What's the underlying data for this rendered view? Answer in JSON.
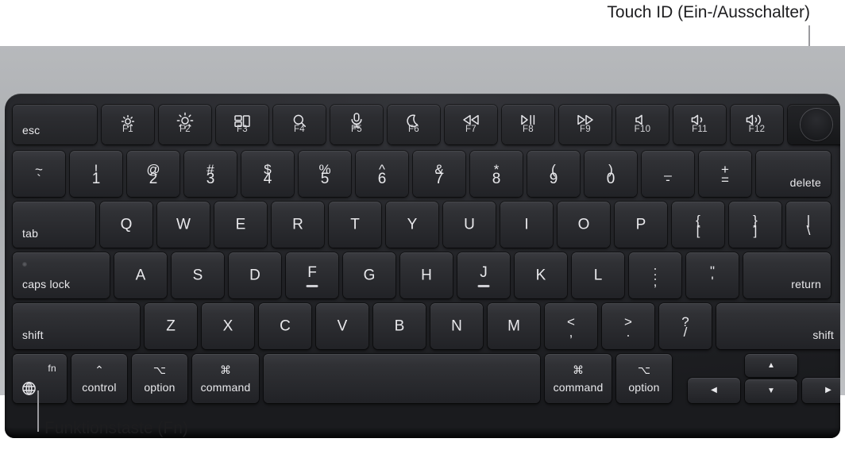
{
  "callouts": {
    "top": "Touch ID (Ein-/Ausschalter)",
    "bottom": "Funktionstaste (Fn)"
  },
  "colors": {
    "key_face": "#303135",
    "key_text": "#e9e9ec",
    "frame": "#26272b",
    "body": "#b7b9bc",
    "callout_text": "#1d1d1f",
    "leader_line": "#9a9a9e"
  },
  "keyboard": {
    "function_row": [
      {
        "name": "esc",
        "label": "esc",
        "fkey": ""
      },
      {
        "name": "brightness-down",
        "icon": "brightness-low-icon",
        "fkey": "F1"
      },
      {
        "name": "brightness-up",
        "icon": "brightness-high-icon",
        "fkey": "F2"
      },
      {
        "name": "mission-control",
        "icon": "mission-control-icon",
        "fkey": "F3"
      },
      {
        "name": "spotlight",
        "icon": "search-icon",
        "fkey": "F4"
      },
      {
        "name": "dictation",
        "icon": "microphone-icon",
        "fkey": "F5"
      },
      {
        "name": "do-not-disturb",
        "icon": "moon-icon",
        "fkey": "F6"
      },
      {
        "name": "rewind",
        "icon": "rewind-icon",
        "fkey": "F7"
      },
      {
        "name": "play-pause",
        "icon": "play-pause-icon",
        "fkey": "F8"
      },
      {
        "name": "fast-forward",
        "icon": "fast-forward-icon",
        "fkey": "F9"
      },
      {
        "name": "mute",
        "icon": "volume-mute-icon",
        "fkey": "F10"
      },
      {
        "name": "volume-down",
        "icon": "volume-down-icon",
        "fkey": "F11"
      },
      {
        "name": "volume-up",
        "icon": "volume-up-icon",
        "fkey": "F12"
      },
      {
        "name": "touch-id",
        "icon": "touch-id-icon",
        "fkey": ""
      }
    ],
    "number_row": [
      {
        "top": "~",
        "bottom": "`"
      },
      {
        "top": "!",
        "bottom": "1"
      },
      {
        "top": "@",
        "bottom": "2"
      },
      {
        "top": "#",
        "bottom": "3"
      },
      {
        "top": "$",
        "bottom": "4"
      },
      {
        "top": "%",
        "bottom": "5"
      },
      {
        "top": "^",
        "bottom": "6"
      },
      {
        "top": "&",
        "bottom": "7"
      },
      {
        "top": "*",
        "bottom": "8"
      },
      {
        "top": "(",
        "bottom": "9"
      },
      {
        "top": ")",
        "bottom": "0"
      },
      {
        "top": "_",
        "bottom": "-"
      },
      {
        "top": "+",
        "bottom": "="
      },
      {
        "label": "delete"
      }
    ],
    "top_letter_row": [
      {
        "label": "tab"
      },
      {
        "label": "Q"
      },
      {
        "label": "W"
      },
      {
        "label": "E"
      },
      {
        "label": "R"
      },
      {
        "label": "T"
      },
      {
        "label": "Y"
      },
      {
        "label": "U"
      },
      {
        "label": "I"
      },
      {
        "label": "O"
      },
      {
        "label": "P"
      },
      {
        "top": "{",
        "bottom": "["
      },
      {
        "top": "}",
        "bottom": "]"
      },
      {
        "top": "|",
        "bottom": "\\"
      }
    ],
    "home_row": [
      {
        "label": "caps lock"
      },
      {
        "label": "A"
      },
      {
        "label": "S"
      },
      {
        "label": "D"
      },
      {
        "label": "F"
      },
      {
        "label": "G"
      },
      {
        "label": "H"
      },
      {
        "label": "J"
      },
      {
        "label": "K"
      },
      {
        "label": "L"
      },
      {
        "top": ":",
        "bottom": ";"
      },
      {
        "top": "\"",
        "bottom": "'"
      },
      {
        "label": "return"
      }
    ],
    "shift_row": [
      {
        "label": "shift"
      },
      {
        "label": "Z"
      },
      {
        "label": "X"
      },
      {
        "label": "C"
      },
      {
        "label": "V"
      },
      {
        "label": "B"
      },
      {
        "label": "N"
      },
      {
        "label": "M"
      },
      {
        "top": "<",
        "bottom": ","
      },
      {
        "top": ">",
        "bottom": "."
      },
      {
        "top": "?",
        "bottom": "/"
      },
      {
        "label": "shift"
      }
    ],
    "bottom_row": {
      "fn": {
        "label": "fn",
        "icon": "globe-icon"
      },
      "control": {
        "symbol": "⌃",
        "label": "control"
      },
      "option_left": {
        "symbol": "⌥",
        "label": "option"
      },
      "command_left": {
        "symbol": "⌘",
        "label": "command"
      },
      "space": {
        "label": ""
      },
      "command_right": {
        "symbol": "⌘",
        "label": "command"
      },
      "option_right": {
        "symbol": "⌥",
        "label": "option"
      },
      "arrow_left": {
        "symbol": "◀",
        "name": "arrow-left"
      },
      "arrow_up": {
        "symbol": "▲",
        "name": "arrow-up"
      },
      "arrow_down": {
        "symbol": "▼",
        "name": "arrow-down"
      },
      "arrow_right": {
        "symbol": "▶",
        "name": "arrow-right"
      }
    }
  }
}
